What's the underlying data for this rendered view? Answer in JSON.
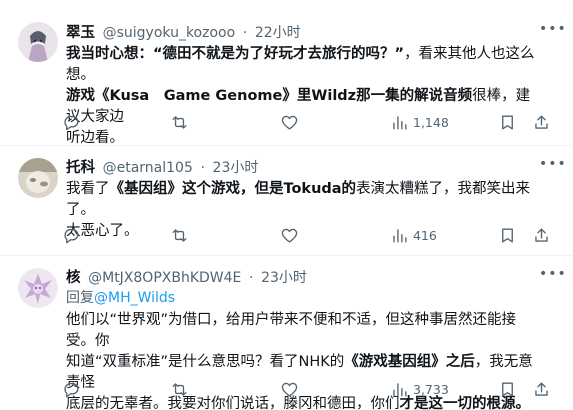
{
  "tweets": [
    {
      "name": "翠玉",
      "handle": "@suigyoku_kozooo",
      "sep": "·",
      "time": "22小时",
      "lines": [
        [
          {
            "t": "我当时心想：“德田不就是为了好玩才去旅行的吗？”",
            "b": true
          },
          {
            "t": "，看来其他人也这么想。",
            "b": false
          }
        ],
        [
          {
            "t": "游戏《Kusa　Game Genome》里Wildz那一集的解说音频",
            "b": true
          },
          {
            "t": "很棒，建议大家边",
            "b": false
          }
        ],
        [
          {
            "t": "听边看。",
            "b": false
          }
        ]
      ],
      "views": "1,148"
    },
    {
      "name": "托科",
      "handle": "@etarnal105",
      "sep": "·",
      "time": "23小时",
      "lines": [
        [
          {
            "t": "我看了",
            "b": false
          },
          {
            "t": "《基因组》这个游戏，但是Tokuda的",
            "b": true
          },
          {
            "t": "表演太糟糕了，我都笑出来了。",
            "b": false
          }
        ],
        [
          {
            "t": "太恶心了。",
            "b": false
          }
        ]
      ],
      "views": "416"
    },
    {
      "name": "核",
      "handle": "@MtJX8OPXBhKDW4E",
      "sep": "·",
      "time": "23小时",
      "reply_prefix": "回复",
      "reply_handle": "@MH_Wilds",
      "lines": [
        [
          {
            "t": "他们以“世界观”为借口，给用户带来不便和不适，但这种事居然还能接受。你",
            "b": false
          }
        ],
        [
          {
            "t": "知道“双重标准”是什么意思吗？看了NHK的",
            "b": false
          },
          {
            "t": "《游戏基因组》之后",
            "b": true
          },
          {
            "t": "，我无意责怪",
            "b": false
          }
        ],
        [
          {
            "t": "底层的无辜者。我要对你们说话，滕冈和德田，你们",
            "b": false
          },
          {
            "t": "才是这一切的根源。",
            "b": true
          }
        ]
      ],
      "views": "3,733"
    }
  ]
}
